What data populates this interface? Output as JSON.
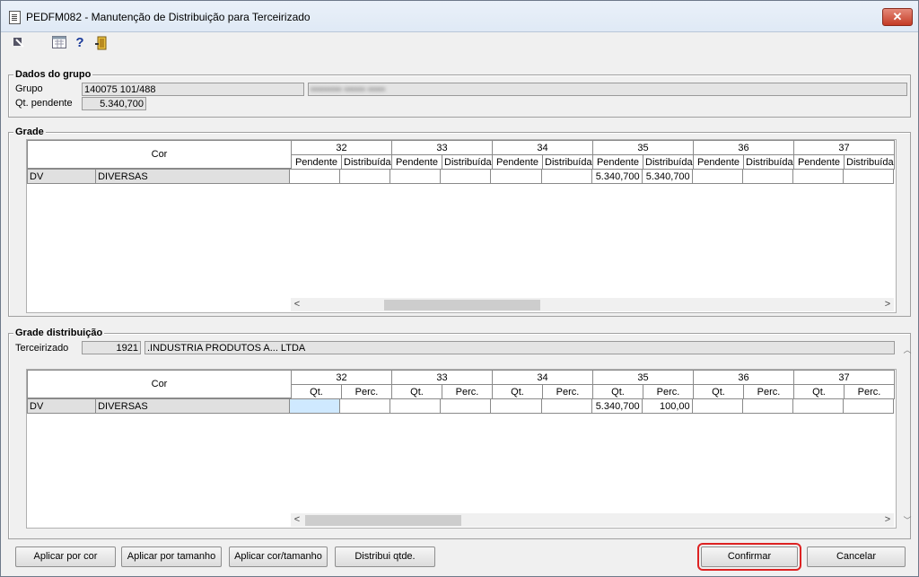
{
  "window": {
    "title": "PEDFM082 - Manutenção de Distribuição para Terceirizado",
    "close_label": "✕"
  },
  "toolbar": {
    "icons": [
      "arrow-icon",
      "calendar-icon",
      "help-icon",
      "exit-door-icon"
    ],
    "help_label": "?"
  },
  "dados_grupo": {
    "title": "Dados do grupo",
    "grupo_label": "Grupo",
    "grupo_value": "140075 101/488",
    "grupo_desc": "••••••••• •••••• •••••",
    "qt_pendente_label": "Qt. pendente",
    "qt_pendente_value": "5.340,700"
  },
  "grade": {
    "title": "Grade",
    "cor_header": "Cor",
    "sizes": [
      "32",
      "33",
      "34",
      "35",
      "36",
      "37"
    ],
    "subheaders": [
      "Pendente",
      "Distribuída"
    ],
    "rows": [
      {
        "code": "DV",
        "name": "DIVERSAS",
        "cells": [
          "",
          "",
          "",
          "",
          "",
          "",
          "5.340,700",
          "5.340,700",
          "",
          "",
          "",
          ""
        ]
      }
    ]
  },
  "grade_distribuicao": {
    "title": "Grade distribuição",
    "terceirizado_label": "Terceirizado",
    "terceirizado_code": "1921",
    "terceirizado_name": ".INDUSTRIA PRODUTOS A... LTDA",
    "cor_header": "Cor",
    "sizes": [
      "32",
      "33",
      "34",
      "35",
      "36",
      "37"
    ],
    "subheaders": [
      "Qt.",
      "Perc."
    ],
    "rows": [
      {
        "code": "DV",
        "name": "DIVERSAS",
        "cells": [
          "",
          "",
          "",
          "",
          "",
          "",
          "5.340,700",
          "100,00",
          "",
          "",
          "",
          ""
        ]
      }
    ]
  },
  "buttons": {
    "aplicar_cor": "Aplicar por cor",
    "aplicar_tamanho": "Aplicar por tamanho",
    "aplicar_cor_tamanho": "Aplicar cor/tamanho",
    "distribui": "Distribui qtde.",
    "confirmar": "Confirmar",
    "cancelar": "Cancelar"
  },
  "colors": {
    "focus_outline": "#dd2222",
    "selected_cell": "#cfe9ff"
  }
}
